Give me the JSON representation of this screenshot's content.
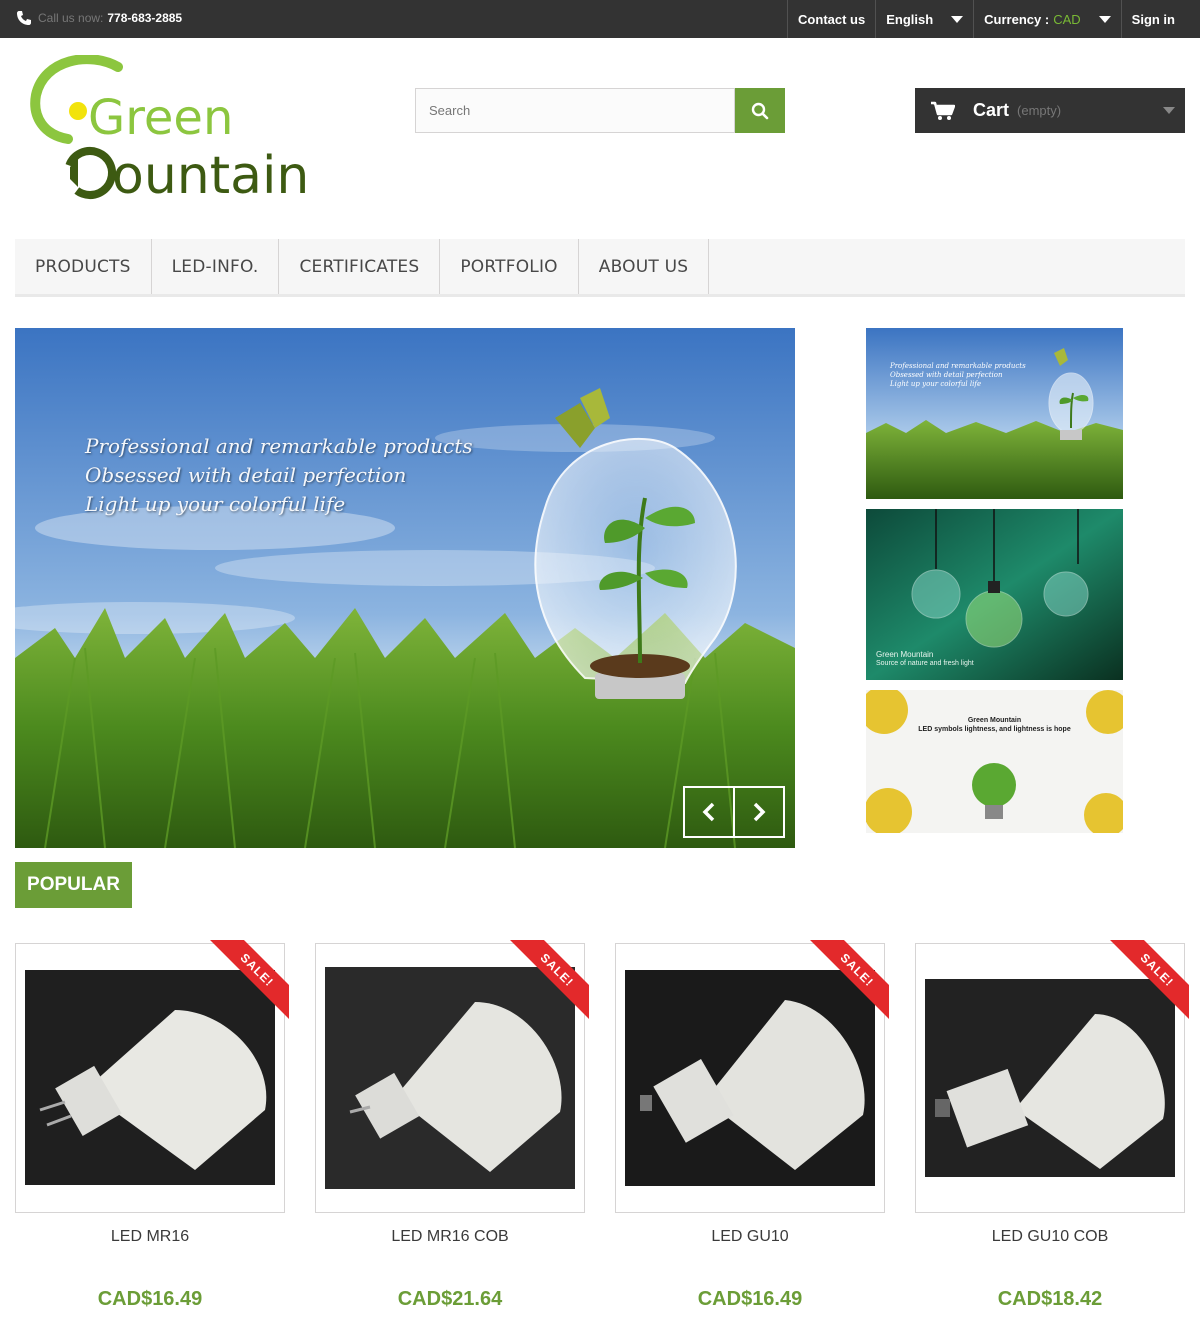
{
  "topbar": {
    "call_label": "Call us now:",
    "phone": "778-683-2885",
    "contact": "Contact us",
    "language": "English",
    "currency_label": "Currency :",
    "currency_value": "CAD",
    "signin": "Sign in"
  },
  "logo": {
    "line1": "Green",
    "line2": "ountain"
  },
  "search": {
    "placeholder": "Search"
  },
  "cart": {
    "label": "Cart",
    "status": "(empty)"
  },
  "menu": [
    "PRODUCTS",
    "LED-INFO.",
    "CERTIFICATES",
    "PORTFOLIO",
    "ABOUT US"
  ],
  "slider": {
    "lines": [
      "Professional and remarkable products",
      "Obsessed with detail perfection",
      "Light up your colorful life"
    ]
  },
  "thumbs": {
    "t1_lines": [
      "Professional and remarkable products",
      "Obsessed with detail perfection",
      "Light up your colorful life"
    ],
    "t2_title": "Green Mountain",
    "t2_sub": "Source of nature and fresh light",
    "t3_title": "Green Mountain",
    "t3_sub": "LED symbols lightness, and lightness is hope"
  },
  "popular_tab": "POPULAR",
  "sale_label": "SALE!",
  "products": [
    {
      "name": "LED MR16",
      "price": "CAD$16.49"
    },
    {
      "name": "LED MR16 COB",
      "price": "CAD$21.64"
    },
    {
      "name": "LED GU10",
      "price": "CAD$16.49"
    },
    {
      "name": "LED GU10 COB",
      "price": "CAD$18.42"
    }
  ],
  "colors": {
    "brand_green": "#6b9d37",
    "logo_green": "#8cc63f",
    "dark_bar": "#333333",
    "sale_red": "#e3292b"
  }
}
